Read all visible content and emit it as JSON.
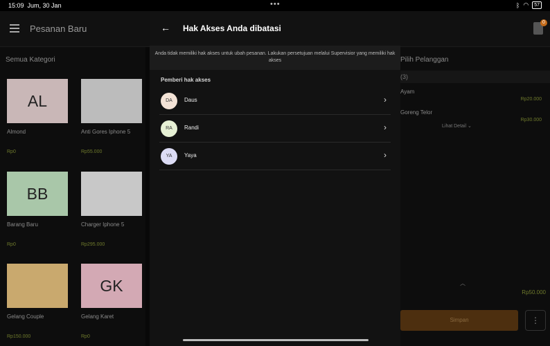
{
  "status": {
    "time": "15:09",
    "date": "Jum, 30 Jan",
    "battery": "57"
  },
  "header": {
    "title": "Pesanan Baru",
    "cart_count": "0"
  },
  "catalog": {
    "title": "Semua Kategori",
    "products": [
      {
        "initials": "AL",
        "name": "Almond",
        "price": "Rp0",
        "color": "#c9b7b7"
      },
      {
        "initials": "",
        "name": "Anti Gores Iphone 5",
        "price": "Rp55.000",
        "color": "#bcbcbc"
      },
      {
        "initials": "BB",
        "name": "Barang Baru",
        "price": "Rp0",
        "color": "#a9c7a9"
      },
      {
        "initials": "",
        "name": "Charger Iphone 5",
        "price": "Rp295.000",
        "color": "#c8c8c8"
      },
      {
        "initials": "",
        "name": "Gelang Couple",
        "price": "Rp150.000",
        "color": "#c9a96e"
      },
      {
        "initials": "GK",
        "name": "Gelang Karet",
        "price": "Rp0",
        "color": "#d3a9b4"
      }
    ]
  },
  "order": {
    "title": "Pilih Pelanggan",
    "count": "(3)",
    "items": [
      {
        "name": "Ayam",
        "sub": "",
        "price": "Rp20.000"
      },
      {
        "name": "Goreng Telor",
        "sub": "",
        "price": "Rp30.000"
      }
    ],
    "detail_label": "Lihat Detail",
    "total": "Rp50.000",
    "save_label": "Simpan"
  },
  "modal": {
    "title": "Hak Akses Anda dibatasi",
    "notice": "Anda tidak memiliki hak akses untuk ubah pesanan. Lakukan persetujuan melalui Supervisior yang memiliki hak akses",
    "section_label": "Pemberi hak akses",
    "approvers": [
      {
        "initials": "DA",
        "name": "Daus",
        "color": "#f3e3d6"
      },
      {
        "initials": "RA",
        "name": "Randi",
        "color": "#e6f0d4"
      },
      {
        "initials": "YA",
        "name": "Yaya",
        "color": "#dcdcf5"
      }
    ]
  }
}
